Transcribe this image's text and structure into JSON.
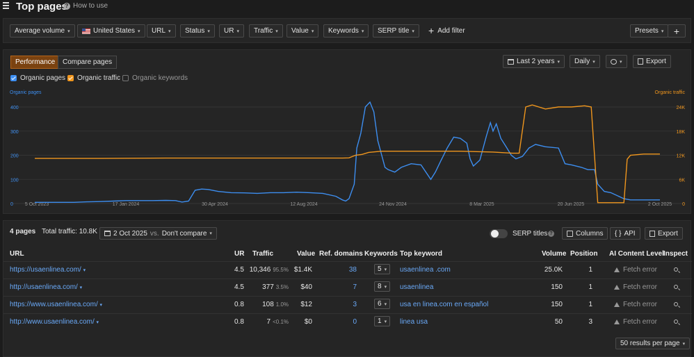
{
  "header": {
    "title": "Top pages",
    "help_label": "How to use"
  },
  "filters": {
    "items": [
      "Average volume",
      "United States",
      "URL",
      "Status",
      "UR",
      "Traffic",
      "Value",
      "Keywords",
      "SERP title"
    ],
    "add_filter": "Add filter",
    "presets": "Presets"
  },
  "chart_panel": {
    "tabs": [
      "Performance",
      "Compare pages"
    ],
    "legend": [
      "Organic pages",
      "Organic traffic",
      "Organic keywords"
    ],
    "period": "Last 2 years",
    "granularity": "Daily",
    "export": "Export"
  },
  "chart_data": {
    "type": "line",
    "left_axis_title": "Organic pages",
    "right_axis_title": "Organic traffic",
    "left_ticks": [
      "400",
      "300",
      "200",
      "100",
      "0"
    ],
    "right_ticks": [
      "24K",
      "18K",
      "12K",
      "6K",
      "0"
    ],
    "x_ticks": [
      "5 Oct 2023",
      "17 Jan 2024",
      "30 Apr 2024",
      "12 Aug 2024",
      "24 Nov 2024",
      "8 Mar 2025",
      "20 Jun 2025",
      "2 Oct 2025"
    ],
    "ylim_left": [
      0,
      400
    ],
    "ylim_right": [
      0,
      24000
    ],
    "series": [
      {
        "name": "Organic pages",
        "color": "#3d8ef0",
        "axis": "left",
        "points": [
          [
            0,
            5
          ],
          [
            20,
            5
          ],
          [
            40,
            5
          ],
          [
            60,
            5
          ],
          [
            80,
            7
          ],
          [
            100,
            8
          ],
          [
            120,
            10
          ],
          [
            140,
            12
          ],
          [
            160,
            12
          ],
          [
            180,
            12
          ],
          [
            200,
            13
          ],
          [
            215,
            12
          ],
          [
            225,
            6
          ],
          [
            235,
            10
          ],
          [
            245,
            55
          ],
          [
            255,
            60
          ],
          [
            265,
            58
          ],
          [
            280,
            50
          ],
          [
            300,
            45
          ],
          [
            320,
            44
          ],
          [
            340,
            42
          ],
          [
            360,
            45
          ],
          [
            380,
            45
          ],
          [
            400,
            47
          ],
          [
            420,
            45
          ],
          [
            440,
            42
          ],
          [
            460,
            30
          ],
          [
            470,
            15
          ],
          [
            475,
            10
          ],
          [
            480,
            20
          ],
          [
            488,
            80
          ],
          [
            492,
            230
          ],
          [
            498,
            290
          ],
          [
            505,
            400
          ],
          [
            512,
            420
          ],
          [
            518,
            380
          ],
          [
            524,
            260
          ],
          [
            530,
            200
          ],
          [
            535,
            150
          ],
          [
            540,
            140
          ],
          [
            550,
            130
          ],
          [
            560,
            150
          ],
          [
            575,
            165
          ],
          [
            590,
            160
          ],
          [
            600,
            120
          ],
          [
            605,
            100
          ],
          [
            612,
            130
          ],
          [
            620,
            175
          ],
          [
            630,
            230
          ],
          [
            640,
            275
          ],
          [
            650,
            270
          ],
          [
            660,
            250
          ],
          [
            665,
            185
          ],
          [
            670,
            155
          ],
          [
            680,
            180
          ],
          [
            690,
            280
          ],
          [
            696,
            335
          ],
          [
            700,
            300
          ],
          [
            705,
            330
          ],
          [
            712,
            270
          ],
          [
            720,
            235
          ],
          [
            728,
            200
          ],
          [
            735,
            185
          ],
          [
            745,
            195
          ],
          [
            755,
            230
          ],
          [
            765,
            245
          ],
          [
            780,
            235
          ],
          [
            800,
            230
          ],
          [
            810,
            165
          ],
          [
            820,
            160
          ],
          [
            835,
            150
          ],
          [
            845,
            140
          ],
          [
            855,
            140
          ],
          [
            860,
            80
          ],
          [
            870,
            50
          ],
          [
            880,
            45
          ],
          [
            900,
            20
          ],
          [
            910,
            15
          ],
          [
            940,
            15
          ],
          [
            955,
            15
          ]
        ]
      },
      {
        "name": "Organic traffic",
        "color": "#f0961d",
        "axis": "right",
        "points": [
          [
            0,
            11200
          ],
          [
            100,
            11200
          ],
          [
            200,
            11300
          ],
          [
            300,
            11300
          ],
          [
            400,
            11300
          ],
          [
            470,
            11300
          ],
          [
            480,
            11350
          ],
          [
            490,
            12000
          ],
          [
            500,
            12200
          ],
          [
            510,
            12700
          ],
          [
            530,
            13000
          ],
          [
            560,
            13000
          ],
          [
            600,
            13000
          ],
          [
            650,
            13000
          ],
          [
            700,
            12800
          ],
          [
            730,
            12500
          ],
          [
            740,
            12500
          ],
          [
            750,
            24000
          ],
          [
            760,
            24500
          ],
          [
            780,
            23500
          ],
          [
            800,
            24000
          ],
          [
            820,
            24000
          ],
          [
            840,
            24300
          ],
          [
            850,
            24000
          ],
          [
            855,
            12000
          ],
          [
            860,
            200
          ],
          [
            870,
            200
          ],
          [
            900,
            200
          ],
          [
            905,
            11000
          ],
          [
            910,
            12000
          ],
          [
            930,
            12300
          ],
          [
            955,
            12300
          ]
        ]
      }
    ]
  },
  "table": {
    "count_label": "4 pages",
    "total_traffic": "Total traffic: 10.8K",
    "date": "2 Oct 2025",
    "vs": "vs.",
    "compare": "Don't compare",
    "serp_titles": "SERP titles",
    "columns_btn": "Columns",
    "api_btn": "API",
    "export_btn": "Export",
    "headers": [
      "URL",
      "UR",
      "Traffic",
      "Value",
      "Ref. domains",
      "Keywords",
      "Top keyword",
      "Volume",
      "Position",
      "AI Content Level",
      "Inspect"
    ],
    "rows": [
      {
        "url": "https://usaenlinea.com/",
        "ur": "4.5",
        "traffic": "10,346",
        "traffic_pct": "95.5%",
        "value": "$1.4K",
        "ref_domains": "38",
        "keywords": "5",
        "top_keyword": "usaenlinea .com",
        "volume": "25.0K",
        "position": "1",
        "ai_level": "Fetch error"
      },
      {
        "url": "http://usaenlinea.com/",
        "ur": "4.5",
        "traffic": "377",
        "traffic_pct": "3.5%",
        "value": "$40",
        "ref_domains": "7",
        "keywords": "8",
        "top_keyword": "usaenlinea",
        "volume": "150",
        "position": "1",
        "ai_level": "Fetch error"
      },
      {
        "url": "https://www.usaenlinea.com/",
        "ur": "0.8",
        "traffic": "108",
        "traffic_pct": "1.0%",
        "value": "$12",
        "ref_domains": "3",
        "keywords": "6",
        "top_keyword": "usa en linea.com en español",
        "volume": "150",
        "position": "1",
        "ai_level": "Fetch error"
      },
      {
        "url": "http://www.usaenlinea.com/",
        "ur": "0.8",
        "traffic": "7",
        "traffic_pct": "<0.1%",
        "value": "$0",
        "ref_domains": "0",
        "keywords": "1",
        "top_keyword": "linea usa",
        "volume": "50",
        "position": "3",
        "ai_level": "Fetch error"
      }
    ],
    "results_per_page": "50 results per page"
  }
}
